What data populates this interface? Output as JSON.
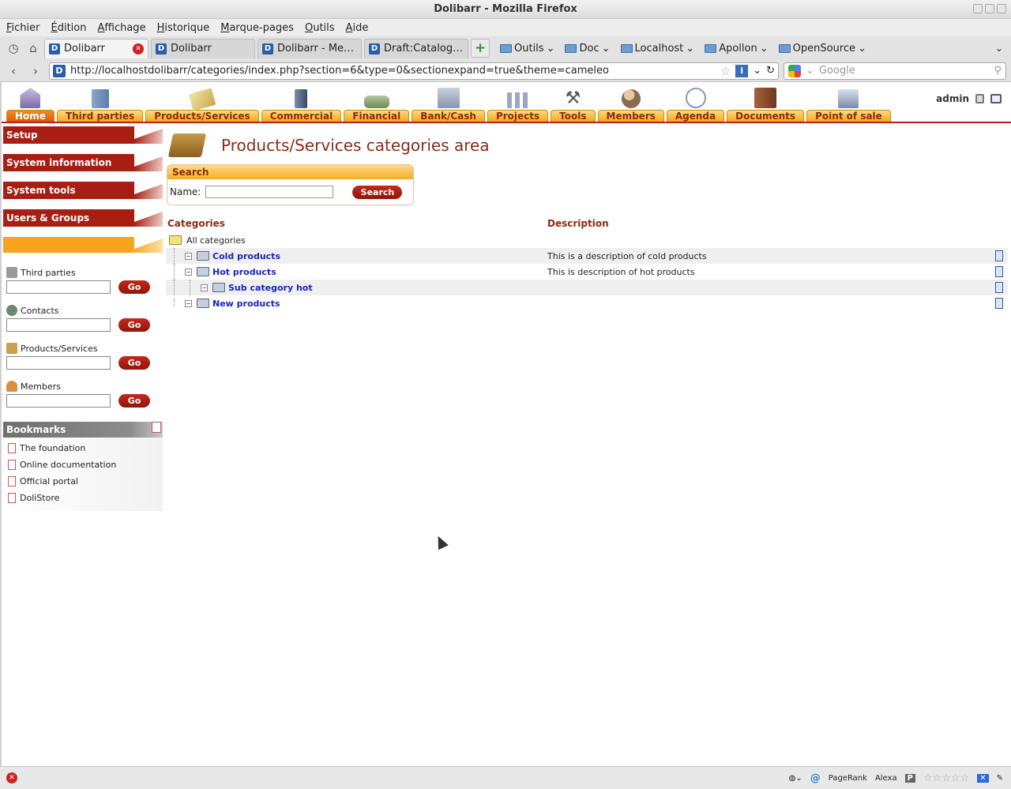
{
  "window": {
    "title": "Dolibarr - Mozilla Firefox"
  },
  "menubar": [
    "Fichier",
    "Édition",
    "Affichage",
    "Historique",
    "Marque-pages",
    "Outils",
    "Aide"
  ],
  "tabs": [
    {
      "label": "Dolibarr"
    },
    {
      "label": "Dolibarr"
    },
    {
      "label": "Dolibarr - Mem..."
    },
    {
      "label": "Draft:Catalogu..."
    }
  ],
  "bookmark_folders": [
    "Outils",
    "Doc",
    "Localhost",
    "Apollon",
    "OpenSource"
  ],
  "urlbar": {
    "url": "http://localhostdolibarr/categories/index.php?section=6&type=0&sectionexpand=true&theme=cameleo"
  },
  "searchbar": {
    "placeholder": "Google"
  },
  "topmenu": [
    {
      "label": "Home",
      "active": true
    },
    {
      "label": "Third parties"
    },
    {
      "label": "Products/Services"
    },
    {
      "label": "Commercial"
    },
    {
      "label": "Financial"
    },
    {
      "label": "Bank/Cash"
    },
    {
      "label": "Projects"
    },
    {
      "label": "Tools"
    },
    {
      "label": "Members"
    },
    {
      "label": "Agenda"
    },
    {
      "label": "Documents"
    },
    {
      "label": "Point of sale"
    }
  ],
  "user": {
    "login": "admin"
  },
  "leftmenu": {
    "sections": [
      "Setup",
      "System information",
      "System tools",
      "Users & Groups"
    ],
    "quicksearch": [
      {
        "label": "Third parties",
        "button": "Go"
      },
      {
        "label": "Contacts",
        "button": "Go"
      },
      {
        "label": "Products/Services",
        "button": "Go"
      },
      {
        "label": "Members",
        "button": "Go"
      }
    ],
    "bookmarks_title": "Bookmarks",
    "bookmarks": [
      "The foundation",
      "Online documentation",
      "Official portal",
      "DoliStore"
    ]
  },
  "main": {
    "title": "Products/Services categories area",
    "search": {
      "title": "Search",
      "name_label": "Name:",
      "button": "Search"
    },
    "columns": {
      "categories": "Categories",
      "description": "Description"
    },
    "root": "All categories",
    "categories": [
      {
        "name": "Cold products",
        "description": "This is a description of cold products",
        "level": 1
      },
      {
        "name": "Hot products",
        "description": "This is description of hot products",
        "level": 1
      },
      {
        "name": "Sub category hot",
        "description": "",
        "level": 2
      },
      {
        "name": "New products",
        "description": "",
        "level": 1
      }
    ]
  },
  "statusbar": {
    "pagerank": "PageRank",
    "alexa": "Alexa"
  }
}
